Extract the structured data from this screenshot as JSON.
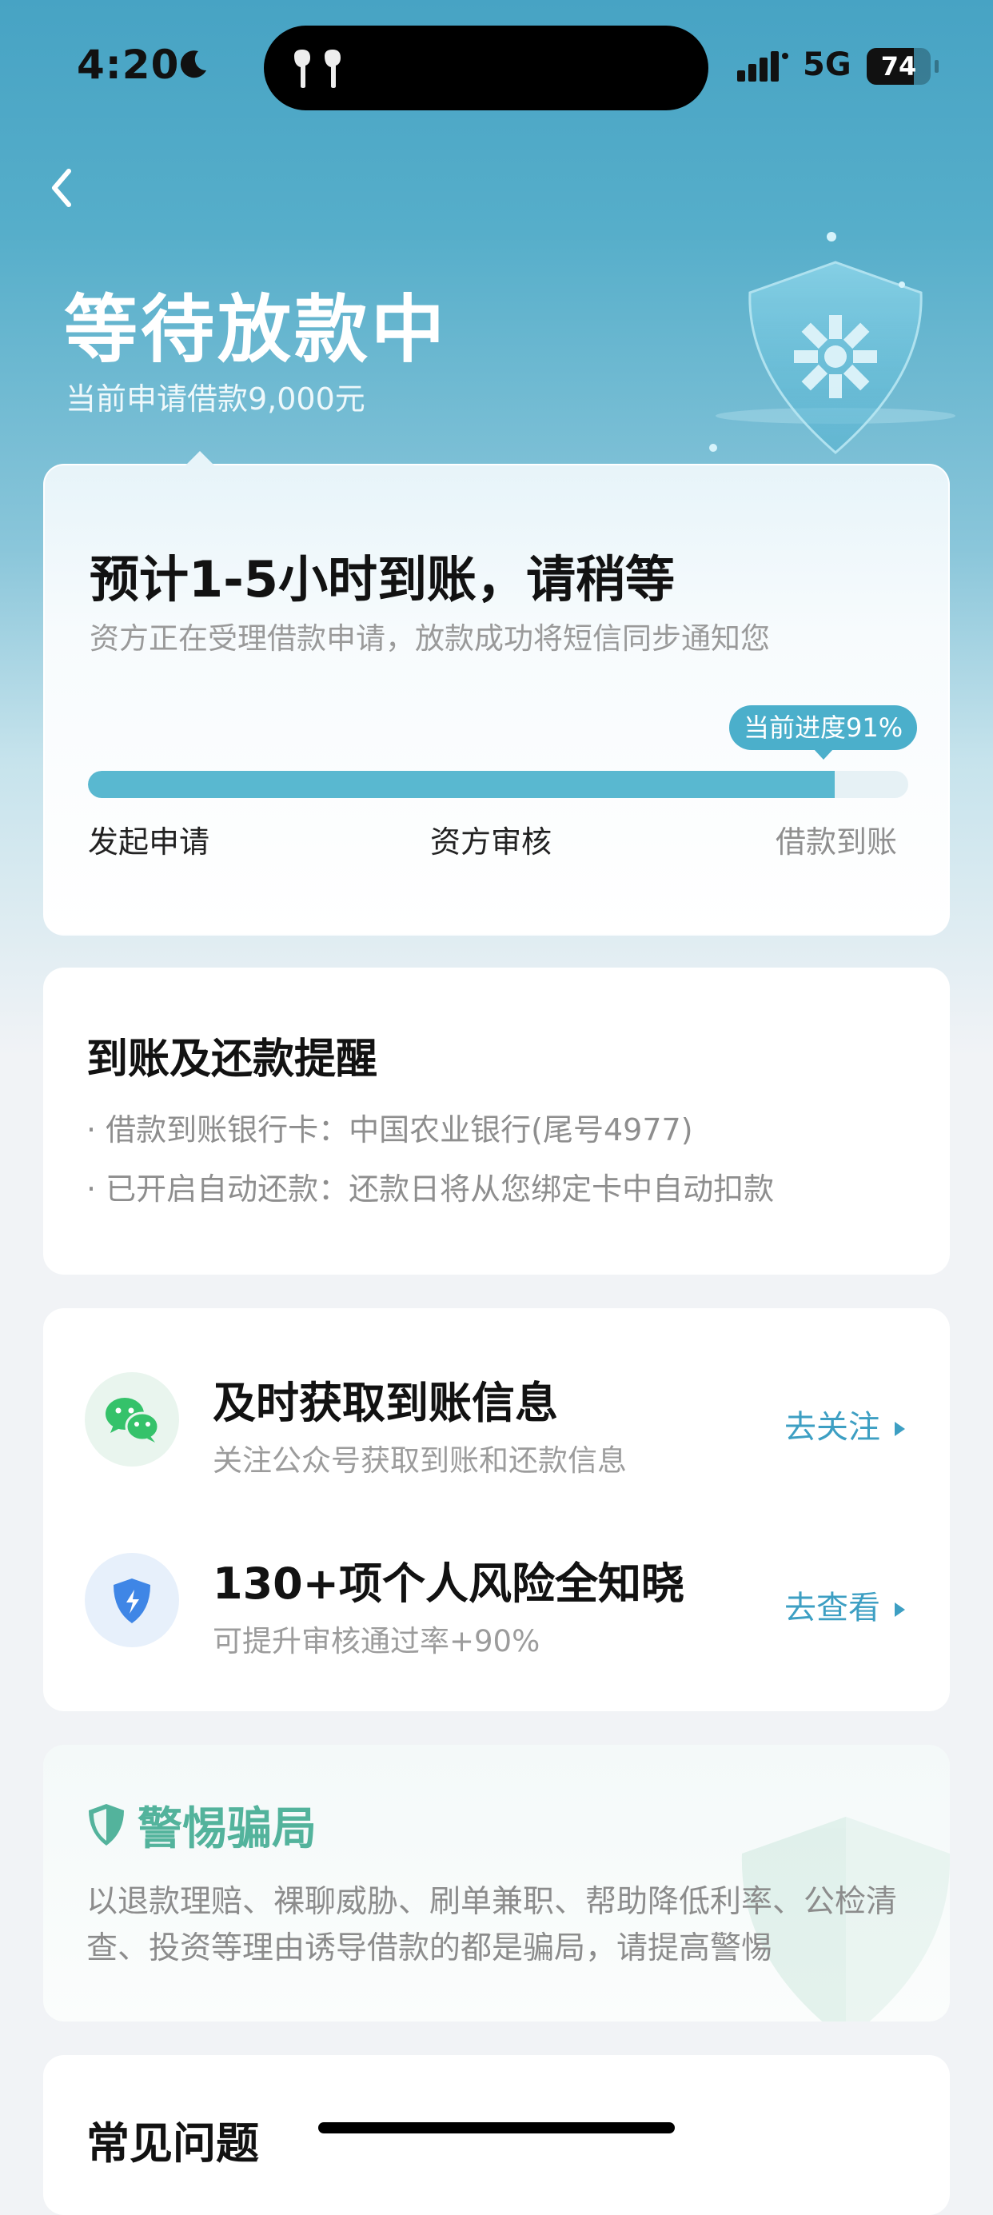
{
  "status_bar": {
    "time": "4:20",
    "network": "5G",
    "battery": "74",
    "battery_level": 0.74
  },
  "header": {
    "title": "等待放款中",
    "subtitle": "当前申请借款9,000元"
  },
  "progress_card": {
    "title": "预计1-5小时到账，请稍等",
    "description": "资方正在受理借款申请，放款成功将短信同步通知您",
    "tooltip": "当前进度91%",
    "progress": 0.91,
    "steps": [
      "发起申请",
      "资方审核",
      "借款到账"
    ]
  },
  "reminder_card": {
    "title": "到账及还款提醒",
    "lines": [
      "· 借款到账银行卡：中国农业银行(尾号4977)",
      "· 已开启自动还款：还款日将从您绑定卡中自动扣款"
    ]
  },
  "follow_card": {
    "items": [
      {
        "icon": "wechat-icon",
        "title": "及时获取到账信息",
        "subtitle": "关注公众号获取到账和还款信息",
        "action": "去关注"
      },
      {
        "icon": "shield-bolt-icon",
        "title": "130+项个人风险全知晓",
        "subtitle": "可提升审核通过率+90%",
        "action": "去查看"
      }
    ]
  },
  "fraud_card": {
    "title": "警惕骗局",
    "body": "以退款理赔、裸聊威胁、刷单兼职、帮助降低利率、公检清查、投资等理由诱导借款的都是骗局，请提高警惕"
  },
  "faq_card": {
    "title": "常见问题"
  },
  "colors": {
    "accent": "#4bafcb",
    "link": "#3d9fc3",
    "fraud_green": "#53b39c",
    "hero_bg": "#47a3c4"
  }
}
